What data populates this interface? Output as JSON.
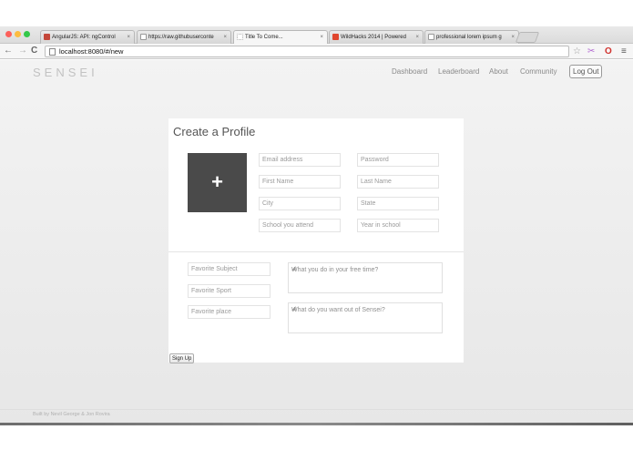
{
  "browser": {
    "tabs": [
      {
        "title": "AngularJS: API: ngControl",
        "icon": "angular-icon",
        "color": "#c4473a"
      },
      {
        "title": "https://raw.githubuserconte",
        "icon": "page-icon",
        "color": "#ffffff"
      },
      {
        "title": "Title To Come...",
        "icon": "page-icon",
        "color": "#ffffff"
      },
      {
        "title": "WildHacks 2014 | Powered",
        "icon": "wildhacks-icon",
        "color": "#e0462e"
      },
      {
        "title": "professional lorem ipsum g",
        "icon": "page-icon",
        "color": "#ffffff"
      }
    ],
    "close_glyph": "×",
    "url": "localhost:8080/#/new"
  },
  "site": {
    "logo": "SENSEI",
    "nav": {
      "dashboard": "Dashboard",
      "leaderboard": "Leaderboard",
      "about": "About",
      "community": "Community",
      "logout": "Log Out"
    }
  },
  "form": {
    "title": "Create a Profile",
    "plus": "+",
    "fields": {
      "email": "Email address",
      "password": "Password",
      "first_name": "First Name",
      "last_name": "Last Name",
      "city": "City",
      "state": "State",
      "school": "School you attend",
      "year": "Year in school",
      "subject": "Favorite Subject",
      "sport": "Favorite Sport",
      "place": "Favorite place",
      "free_time": "What you do in your free time?",
      "want_out": "What do you want out of Sensei?"
    },
    "submit": "Sign Up"
  },
  "footer": {
    "credit": "Built by Nevil George & Jon Rovira"
  },
  "colors": {
    "avatar_box": "#4a4a4a",
    "page_bg": "#efefef",
    "card_bg": "#ffffff"
  }
}
